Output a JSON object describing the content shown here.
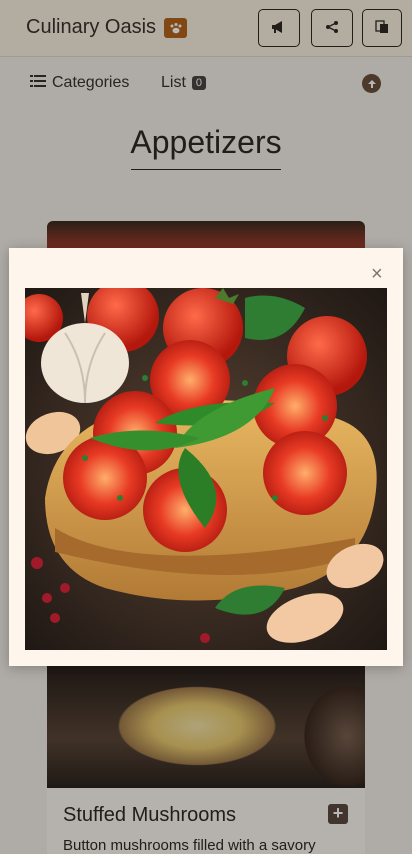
{
  "header": {
    "brand": "Culinary Oasis",
    "buttons": [
      {
        "icon": "megaphone-icon"
      },
      {
        "icon": "share-icon"
      },
      {
        "icon": "translate-icon"
      }
    ]
  },
  "nav": {
    "categories_label": "Categories",
    "list_label": "List",
    "list_count": "0"
  },
  "page": {
    "title": "Appetizers"
  },
  "card": {
    "name": "Stuffed Mushrooms",
    "description": "Button mushrooms filled with a savory"
  },
  "modal": {
    "close_glyph": "×",
    "image_subject": "bruschetta-photo"
  },
  "colors": {
    "accent": "#b5651d",
    "modal_bg": "#fef6ec",
    "text": "#2f2a25"
  }
}
